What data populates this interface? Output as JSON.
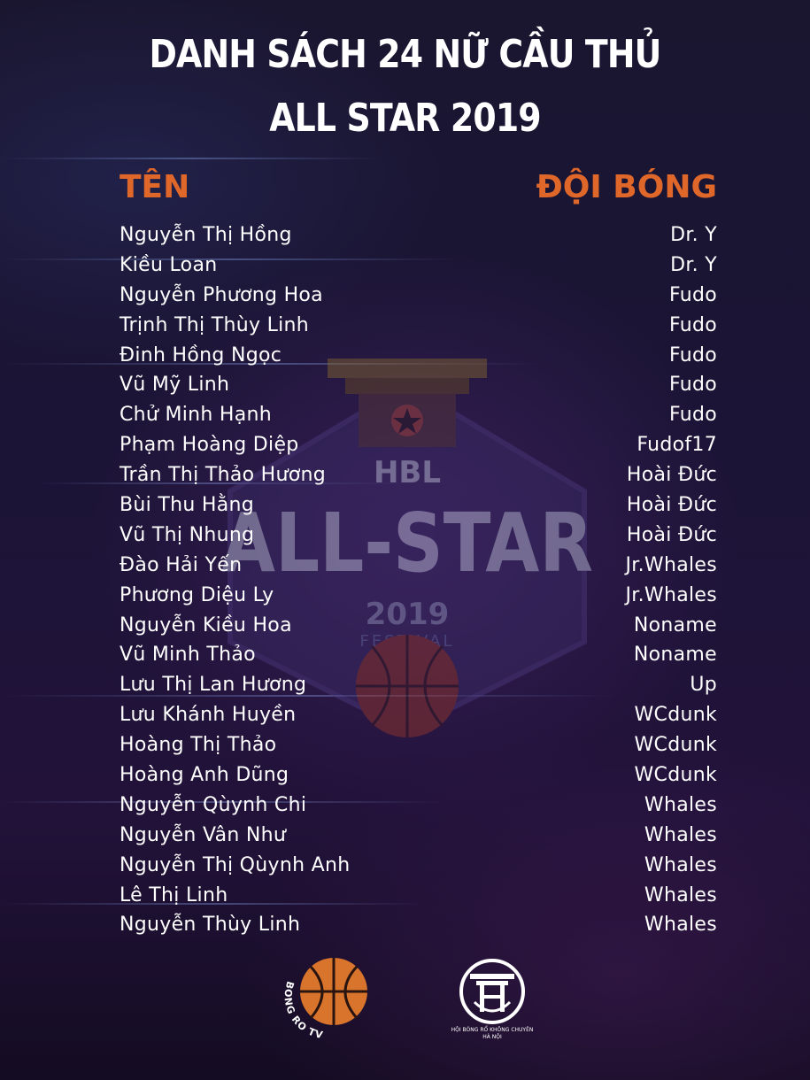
{
  "title": {
    "line1": "DANH SÁCH 24 NỮ CẦU THỦ",
    "line2": "ALL STAR 2019"
  },
  "columns": {
    "name_header": "TÊN",
    "team_header": "ĐỘI BÓNG"
  },
  "players": [
    {
      "name": "Nguyễn Thị Hồng",
      "team": "Dr. Y"
    },
    {
      "name": "Kiều Loan",
      "team": "Dr. Y"
    },
    {
      "name": "Nguyễn Phương Hoa",
      "team": "Fudo"
    },
    {
      "name": "Trịnh Thị Thùy Linh",
      "team": "Fudo"
    },
    {
      "name": "Đinh Hồng Ngọc",
      "team": "Fudo"
    },
    {
      "name": "Vũ Mỹ Linh",
      "team": "Fudo"
    },
    {
      "name": "Chử Minh Hạnh",
      "team": "Fudo"
    },
    {
      "name": "Phạm Hoàng Diệp",
      "team": "Fudof17"
    },
    {
      "name": "Trần Thị Thảo Hương",
      "team": "Hoài Đức"
    },
    {
      "name": "Bùi Thu Hằng",
      "team": "Hoài Đức"
    },
    {
      "name": "Vũ Thị Nhung",
      "team": "Hoài Đức"
    },
    {
      "name": "Đào Hải Yến",
      "team": "Jr.Whales"
    },
    {
      "name": "Phương Diệu Ly",
      "team": "Jr.Whales"
    },
    {
      "name": "Nguyễn Kiều Hoa",
      "team": "Noname"
    },
    {
      "name": "Vũ Minh Thảo",
      "team": "Noname"
    },
    {
      "name": "Lưu Thị Lan Hương",
      "team": "Up"
    },
    {
      "name": "Lưu Khánh Huyền",
      "team": "WCdunk"
    },
    {
      "name": "Hoàng Thị Thảo",
      "team": "WCdunk"
    },
    {
      "name": "Hoàng Anh Dũng",
      "team": "WCdunk"
    },
    {
      "name": "Nguyễn Qùynh Chi",
      "team": "Whales"
    },
    {
      "name": "Nguyễn Vân Như",
      "team": "Whales"
    },
    {
      "name": "Nguyễn Thị Qùynh Anh",
      "team": "Whales"
    },
    {
      "name": "Lê Thị Linh",
      "team": "Whales"
    },
    {
      "name": "Nguyễn Thùy Linh",
      "team": "Whales"
    }
  ],
  "emblem": {
    "top_text": "HBL",
    "main_text": "ALL-STAR",
    "year": "2019",
    "sub_text": "FESTIVAL"
  },
  "logos": {
    "bongro_text": "BONG RO TV",
    "hoi_text_line1": "HỘI BÓNG RỔ KHÔNG CHUYÊN",
    "hoi_text_line2": "HÀ NỘI"
  },
  "colors": {
    "accent": "#e0672a",
    "text": "#ffffff",
    "background": "#1b1436"
  }
}
